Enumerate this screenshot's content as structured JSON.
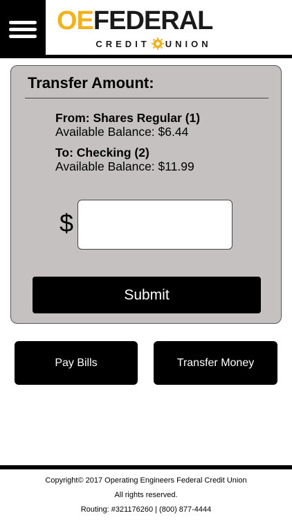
{
  "header": {
    "logo_primary_accent": "OE",
    "logo_primary_rest": "FEDERAL",
    "logo_secondary_left": "CREDIT",
    "logo_secondary_right": "UNION"
  },
  "transfer": {
    "title": "Transfer Amount:",
    "from_label": "From: Shares Regular (1)",
    "from_balance": "Available Balance: $6.44",
    "to_label": "To: Checking (2)",
    "to_balance": "Available Balance: $11.99",
    "currency_symbol": "$",
    "amount_value": "",
    "submit_label": "Submit"
  },
  "nav": {
    "pay_bills": "Pay Bills",
    "transfer_money": "Transfer Money"
  },
  "footer": {
    "copyright": "Copyright© 2017 Operating Engineers Federal Credit Union",
    "rights": "All rights reserved.",
    "routing": "Routing: #321176260 | (800) 877-4444"
  },
  "colors": {
    "brand_gold": "#f2b21b",
    "card_bg": "#c5c1c1",
    "button_bg": "#000000"
  },
  "icons": [
    "hamburger-menu-icon",
    "gear-icon"
  ]
}
